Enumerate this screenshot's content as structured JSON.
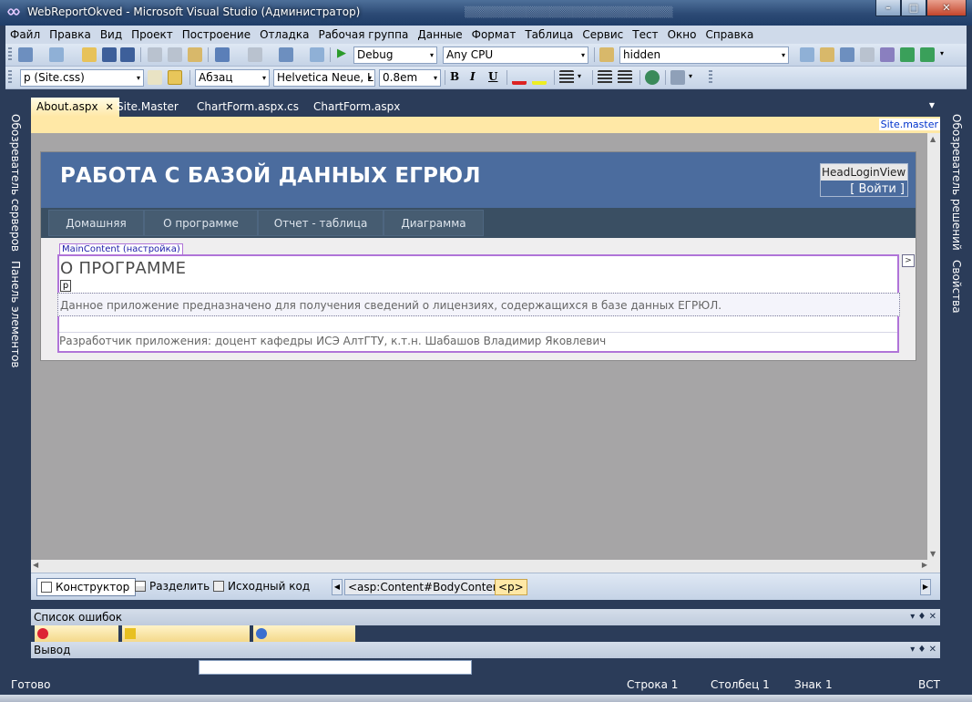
{
  "window": {
    "title": "WebReportOkved - Microsoft Visual Studio (Администратор)",
    "minimize_glyph": "–",
    "maximize_glyph": "□",
    "close_glyph": "✕"
  },
  "menu": [
    "Файл",
    "Правка",
    "Вид",
    "Проект",
    "Построение",
    "Отладка",
    "Рабочая группа",
    "Данные",
    "Формат",
    "Таблица",
    "Сервис",
    "Тест",
    "Окно",
    "Справка"
  ],
  "toolbar": {
    "configuration": "Debug",
    "platform": "Any CPU",
    "find_value": "hidden",
    "style_rule": "p (Site.css)",
    "block_format": "Абзац",
    "font_name": "Helvetica Neue, L",
    "font_size": "0.8em",
    "bold": "B",
    "italic": "I",
    "underline": "U",
    "dropdown_glyph": "▾",
    "run_glyph": "▶"
  },
  "side_tabs": {
    "left": [
      "Обозреватель серверов",
      "Панель элементов"
    ],
    "right": [
      "Обозреватель решений",
      "Свойства"
    ]
  },
  "doc_tabs": [
    {
      "label": "About.aspx",
      "active": true
    },
    {
      "label": "Site.Master",
      "active": false
    },
    {
      "label": "ChartForm.aspx.cs",
      "active": false
    },
    {
      "label": "ChartForm.aspx",
      "active": false
    }
  ],
  "doc_tab_close_glyph": "✕",
  "doc_tabs_menu_glyph": "▼",
  "editor": {
    "master_link": "Site.master",
    "page_title": "РАБОТА С БАЗОЙ ДАННЫХ ЕГРЮЛ",
    "login_view_label": "HeadLoginView",
    "login_link": "[ Войти ]",
    "nav": [
      "Домашняя",
      "О программе",
      "Отчет - таблица",
      "Диаграмма"
    ],
    "content_placeholder_tag": "MainContent (настройка)",
    "smart_tag_glyph": ">",
    "heading": "О ПРОГРАММЕ",
    "p_tag": "p",
    "paragraph1": "Данное приложение предназначено для получения сведений о лицензиях, содержащихся в базе данных ЕГРЮЛ.",
    "paragraph2": "Разработчик приложения: доцент кафедры ИСЭ АлтГТУ, к.т.н. Шабашов Владимир Яковлевич",
    "scroll_up_glyph": "▲",
    "scroll_down_glyph": "▼",
    "scroll_left_glyph": "◀",
    "scroll_right_glyph": "▶"
  },
  "view_bar": {
    "design": "Конструктор",
    "split": "Разделить",
    "source": "Исходный код",
    "crumb_left_glyph": "◀",
    "crumb_right_glyph": "▶",
    "crumbs": [
      "<asp:Content#BodyContent>",
      "<p>"
    ]
  },
  "panels": {
    "errors_title": "Список ошибок",
    "output_title": "Вывод",
    "header_icons": "▾  ♦  ✕"
  },
  "status": {
    "ready": "Готово",
    "line": "Строка 1",
    "column": "Столбец 1",
    "char": "Знак 1",
    "mode": "ВСТ"
  },
  "colors": {
    "chrome": "#2b3c59",
    "site_header": "#4b6c9e",
    "site_nav": "#3a4f63",
    "active_tab": "#ffe8a6",
    "content_border": "#b074d8"
  }
}
